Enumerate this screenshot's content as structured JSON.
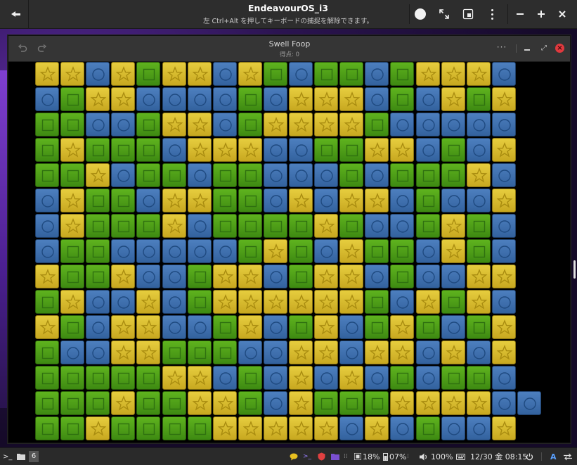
{
  "viewer": {
    "title": "EndeavourOS_i3",
    "subtitle": "左 Ctrl+Alt を押してキーボードの捕捉を解除できます。"
  },
  "game": {
    "title": "Swell Foop",
    "score": "得点: 0",
    "grid": [
      "yybygyybygbggbgyyyb",
      "bgyybbbbgbyyybgbygy",
      "ggbbgyybgyyyygbbbbb",
      "gygggbyyybbggyybgby",
      "ggybggbggbbbgbgggyb",
      "byggbyyggbybyybgbby",
      "bygggybggggygbbgygb",
      "bggbbbbbgygbyggbygb",
      "yggybbgyybgyybgbbyy",
      "gybbybgyyyyyygbygyb",
      "ygbyybbgybgybgygbgy",
      "gbbyygggbbyybyybyby",
      "gggggyybgbybybgbggb",
      "gggyggyygbygggyyyybb",
      "ggyggggyyyyybybgbby"
    ]
  },
  "taskbar": {
    "terminal_icon": ">_",
    "workspace": "6",
    "cpu": "18%",
    "mem": "07%",
    "volume": "100%",
    "datetime": "12/30 金 08:15",
    "lang": "A"
  },
  "colors": {
    "yellow": "#d8bc2e",
    "green": "#4e9e18",
    "blue": "#3f70ae",
    "close": "#e0393e"
  }
}
